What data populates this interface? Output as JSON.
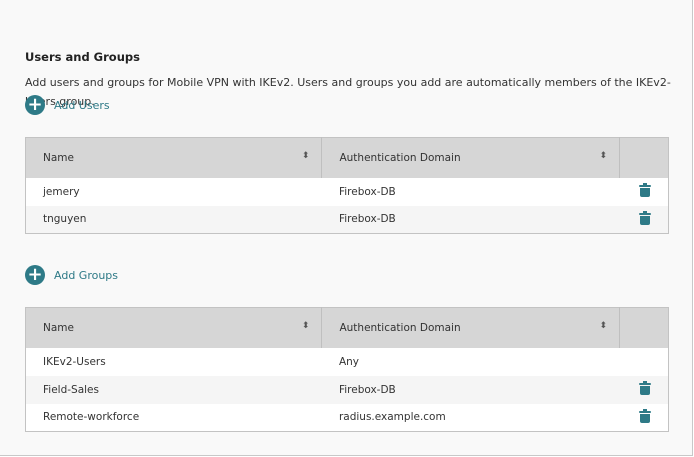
{
  "title": "Users and Groups",
  "description": "Add users and groups for Mobile VPN with IKEv2. Users and groups you add are automatically members of the IKEv2-Users group.",
  "accent": "#2e7a87",
  "users": {
    "add_label": "Add Users",
    "columns": [
      "Name",
      "Authentication Domain"
    ],
    "rows": [
      {
        "name": "jemery",
        "domain": "Firebox-DB",
        "deletable": true
      },
      {
        "name": "tnguyen",
        "domain": "Firebox-DB",
        "deletable": true
      }
    ]
  },
  "groups": {
    "add_label": "Add Groups",
    "columns": [
      "Name",
      "Authentication Domain"
    ],
    "rows": [
      {
        "name": "IKEv2-Users",
        "domain": "Any",
        "deletable": false
      },
      {
        "name": "Field-Sales",
        "domain": "Firebox-DB",
        "deletable": true
      },
      {
        "name": "Remote-workforce",
        "domain": "radius.example.com",
        "deletable": true
      }
    ]
  }
}
